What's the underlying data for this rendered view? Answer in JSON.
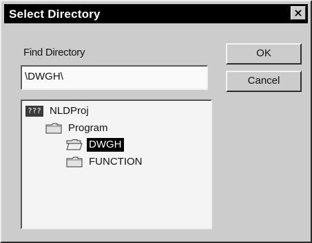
{
  "window": {
    "title": "Select Directory",
    "close_glyph": "×"
  },
  "find": {
    "label": "Find Directory",
    "value": "\\DWGH\\"
  },
  "buttons": {
    "ok": "OK",
    "cancel": "Cancel"
  },
  "tree": {
    "root": {
      "label": "NLDProj",
      "icon": "drive-icon",
      "icon_text": "???"
    },
    "items": [
      {
        "label": "Program",
        "icon": "folder-closed-icon",
        "selected": false
      },
      {
        "label": "DWGH",
        "icon": "folder-open-icon",
        "selected": true
      },
      {
        "label": "FUNCTION",
        "icon": "folder-closed-icon",
        "selected": false
      }
    ]
  },
  "colors": {
    "dialog_bg": "#cccccc",
    "titlebar_bg": "#000000",
    "selection_bg": "#000000"
  }
}
